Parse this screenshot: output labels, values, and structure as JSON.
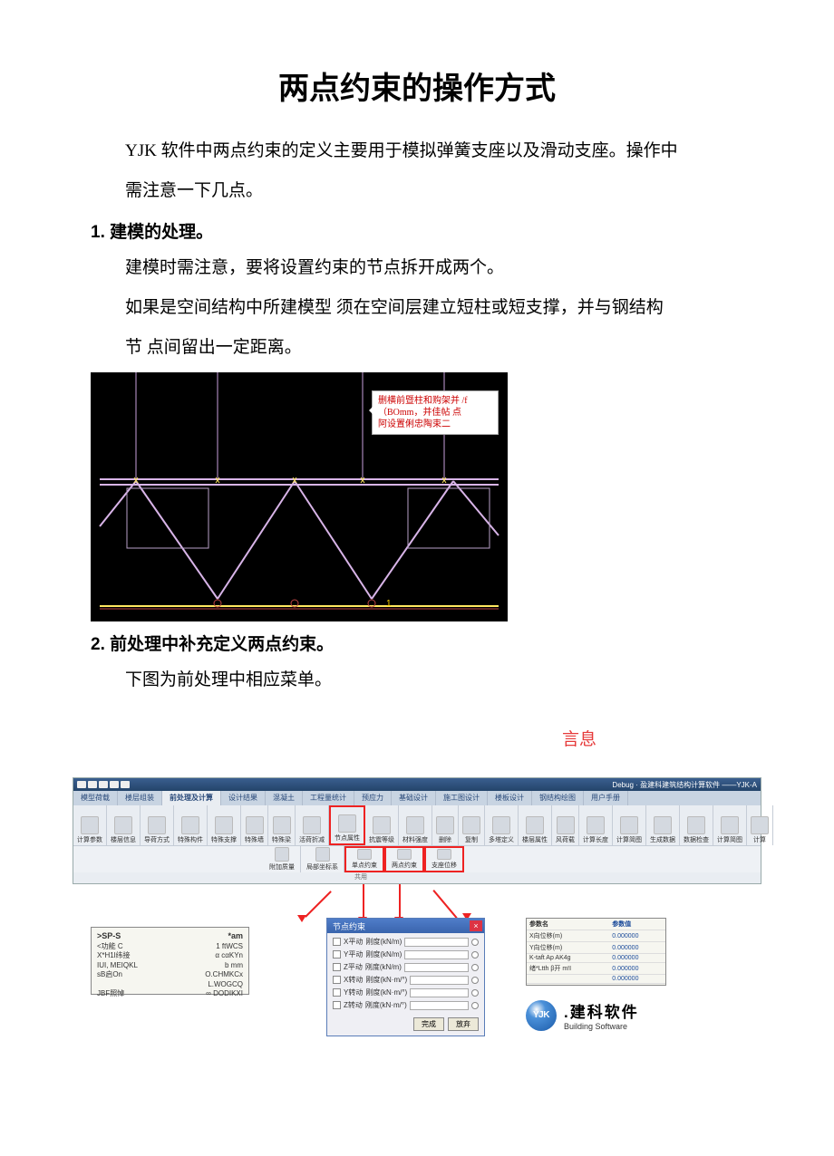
{
  "title": "两点约束的操作方式",
  "intro": "YJK 软件中两点约束的定义主要用于模拟弹簧支座以及滑动支座。操作中",
  "intro2": "需注意一下几点。",
  "sec1": {
    "heading": "1.  建模的处理。",
    "p1": "建模时需注意，要将设置约束的节点拆开成两个。",
    "p2": "如果是空间结构中所建模型 须在空间层建立短柱或短支撑，并与钢结构",
    "p2b": "节  点间留出一定距离。"
  },
  "fig1": {
    "callout_l1": "删横前暨柱和购架并 /f",
    "callout_l2": "（BOmm，并佳帖 点",
    "callout_l3": "阿设置俐忠陶束二",
    "num": "1"
  },
  "sec2": {
    "heading": "2.  前处理中补充定义两点约束。",
    "p1": "下图为前处理中相应菜单。"
  },
  "red_label": "言息",
  "ribbon": {
    "title_right": "Debug · 盈建科建筑结构计算软件 ——YJK-A",
    "tabs": [
      "模型荷载",
      "楼层组装",
      "前处理及计算",
      "设计结果",
      "混凝土",
      "工程量统计",
      "预应力",
      "基础设计",
      "施工图设计",
      "楼板设计",
      "钢结构绘图",
      "用户手册"
    ],
    "active_tab": 2,
    "groups": [
      "计算参数",
      "楼层信息",
      "导荷方式",
      "特殊构件",
      "特殊支撑",
      "特殊墙",
      "特殊梁",
      "活荷折减",
      "节点属性",
      "抗震等级",
      "材料强度",
      "删除",
      "复制",
      "多塔定义",
      "楼层属性",
      "风荷载",
      "计算长度",
      "计算简图",
      "生成数据",
      "数据检查",
      "计算简图",
      "计算"
    ],
    "sub": [
      "附加质量",
      "局部坐标系",
      "单点约束",
      "两点约束",
      "支座位移"
    ],
    "sub_caption": "共用"
  },
  "panel_list": {
    "l1a": ">SP-S",
    "l1b": "*am",
    "l2a": "<功能 C",
    "l2b": "1 ftWCS",
    "l3a": "X*H1l纬接",
    "l3b": "α cαKYn",
    "l4a": "IUI, MEIQKL",
    "l4b": "b mm",
    "l5a": "sB启On",
    "l5b": "O.CHMKCx",
    "l6a": "",
    "l6b": "L.WOGCQ",
    "l7a": "JBF照悼",
    "l7b": "∞ DODIKXI"
  },
  "dialog": {
    "title": "节点约束",
    "rows": [
      {
        "lab": "X平动",
        "unit": "刚度(kN/m)"
      },
      {
        "lab": "Y平动",
        "unit": "刚度(kN/m)"
      },
      {
        "lab": "Z平动",
        "unit": "刚度(kN/m)"
      },
      {
        "lab": "X转动",
        "unit": "刚度(kN·m/°)"
      },
      {
        "lab": "Y转动",
        "unit": "刚度(kN·m/°)"
      },
      {
        "lab": "Z转动",
        "unit": "刚度(kN·m/°)"
      }
    ],
    "btn_ok": "完成",
    "btn_cancel": "放弃"
  },
  "table": {
    "h1": "参数名",
    "h2": "参数值",
    "rows": [
      [
        "X向位移(m)",
        "0.000000"
      ],
      [
        "Y向位移(m)",
        "0.000000"
      ],
      [
        "K-taft Ap AK4g",
        "0.000000"
      ],
      [
        "绪*Ltth β开 m!I",
        "0.000000"
      ],
      [
        "",
        "0.000000"
      ]
    ]
  },
  "logo": {
    "abbr": "YJK",
    "cn": ".建科软件",
    "en": "Building Software"
  }
}
